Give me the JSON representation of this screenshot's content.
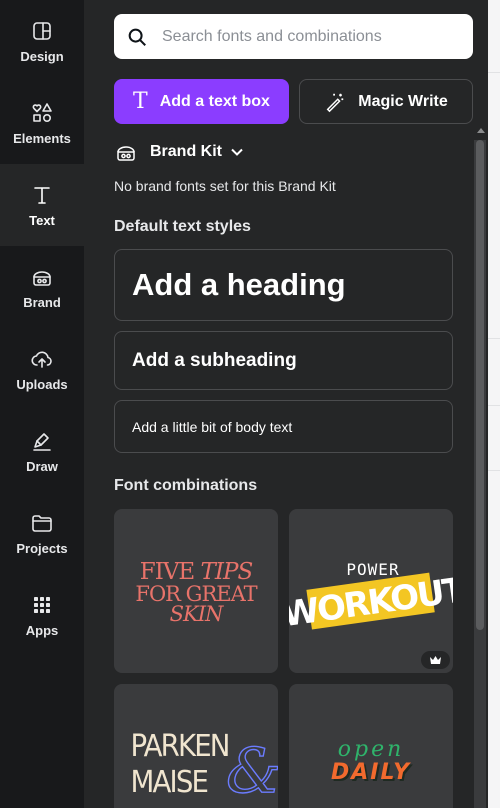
{
  "sidebar": {
    "items": [
      {
        "label": "Design",
        "icon": "design-icon"
      },
      {
        "label": "Elements",
        "icon": "elements-icon"
      },
      {
        "label": "Text",
        "icon": "text-icon",
        "active": true
      },
      {
        "label": "Brand",
        "icon": "brand-icon"
      },
      {
        "label": "Uploads",
        "icon": "uploads-icon"
      },
      {
        "label": "Draw",
        "icon": "draw-icon"
      },
      {
        "label": "Projects",
        "icon": "projects-icon"
      },
      {
        "label": "Apps",
        "icon": "apps-icon"
      }
    ]
  },
  "search": {
    "placeholder": "Search fonts and combinations",
    "icon": "search-icon"
  },
  "actions": {
    "add_text_box": "Add a text box",
    "magic_write": "Magic Write"
  },
  "brand_kit": {
    "label": "Brand Kit",
    "empty_message": "No brand fonts set for this Brand Kit"
  },
  "default_styles": {
    "title": "Default text styles",
    "heading": "Add a heading",
    "subheading": "Add a subheading",
    "body": "Add a little bit of body text"
  },
  "font_combinations": {
    "title": "Font combinations",
    "items": [
      {
        "text": "FIVE TIPS FOR GREAT SKIN",
        "color": "#e8736a"
      },
      {
        "text": "POWER WORKOUT",
        "premium": true,
        "color": "#f3c623"
      },
      {
        "text": "PARKEN & MAISE",
        "color": "#f0e5cf"
      },
      {
        "text": "open DAILY",
        "color": "#f26a2e"
      }
    ]
  },
  "colors": {
    "accent": "#8b3dff",
    "panel": "#252627",
    "rail": "#18191b"
  }
}
